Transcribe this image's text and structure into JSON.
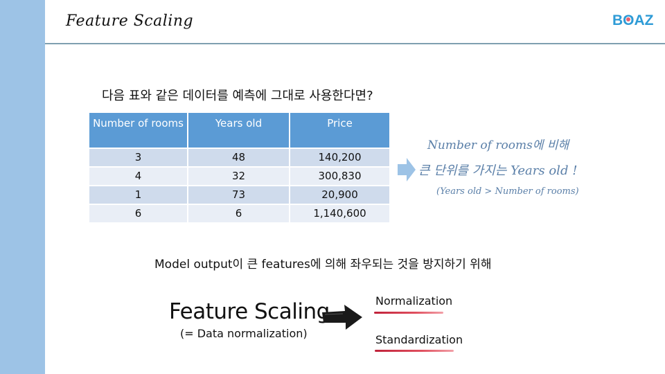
{
  "header": {
    "title": "Feature Scaling",
    "logo": {
      "prefix": "B",
      "o": "O",
      "suffix": "AZ"
    }
  },
  "colors": {
    "sidebar": "#9dc3e6",
    "table_header": "#5b9bd5",
    "row_odd": "#cfdbec",
    "row_even": "#e9eef6",
    "note_text": "#5a7fa8",
    "underline": "#d0303f",
    "logo": "#2e9bd6"
  },
  "question": "다음 표와 같은 데이터를 예측에 그대로 사용한다면?",
  "table": {
    "headers": [
      "Number of rooms",
      "Years old",
      "Price"
    ],
    "rows": [
      [
        "3",
        "48",
        "140,200"
      ],
      [
        "4",
        "32",
        "300,830"
      ],
      [
        "1",
        "73",
        "20,900"
      ],
      [
        "6",
        "6",
        "1,140,600"
      ]
    ]
  },
  "annotation": {
    "line1": "Number of rooms에 비해",
    "line2": "큰 단위를 가지는 Years old !",
    "line3": "(Years old > Number of rooms)"
  },
  "subtitle": "Model output이 큰 features에 의해 좌우되는 것을 방지하기 위해",
  "feature_scaling": {
    "title": "Feature Scaling",
    "subtitle": "(= Data normalization)",
    "methods": [
      "Normalization",
      "Standardization"
    ]
  }
}
